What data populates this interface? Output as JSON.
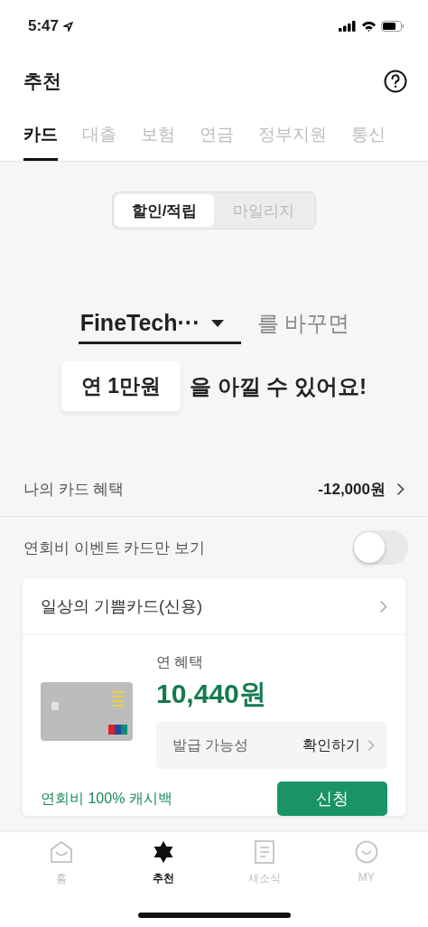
{
  "status_bar": {
    "time": "5:47"
  },
  "header": {
    "title": "추천"
  },
  "tabs": [
    {
      "label": "카드",
      "selected": true
    },
    {
      "label": "대출",
      "selected": false
    },
    {
      "label": "보험",
      "selected": false
    },
    {
      "label": "연금",
      "selected": false
    },
    {
      "label": "정부지원",
      "selected": false
    },
    {
      "label": "통신",
      "selected": false
    }
  ],
  "segments": [
    {
      "label": "할인/적립",
      "selected": true
    },
    {
      "label": "마일리지",
      "selected": false
    }
  ],
  "headline": {
    "card_select": "FineTech···",
    "line1_rest": "를 바꾸면",
    "amount": "연 1만원",
    "line2_rest": "을 아낄 수 있어요!"
  },
  "my_benefit": {
    "label": "나의 카드 혜택",
    "value": "-12,000원"
  },
  "event_filter": {
    "label": "연회비 이벤트 카드만 보기",
    "on": false
  },
  "card": {
    "name": "일상의 기쁨카드(신용)",
    "benefit_label": "연 혜택",
    "benefit_value": "10,440원",
    "issue_label": "발급 가능성",
    "issue_action": "확인하기",
    "promo": "연회비 100% 캐시백",
    "apply": "신청"
  },
  "bottom_nav": [
    {
      "label": "홈",
      "selected": false
    },
    {
      "label": "추천",
      "selected": true
    },
    {
      "label": "새소식",
      "selected": false
    },
    {
      "label": "MY",
      "selected": false
    }
  ]
}
